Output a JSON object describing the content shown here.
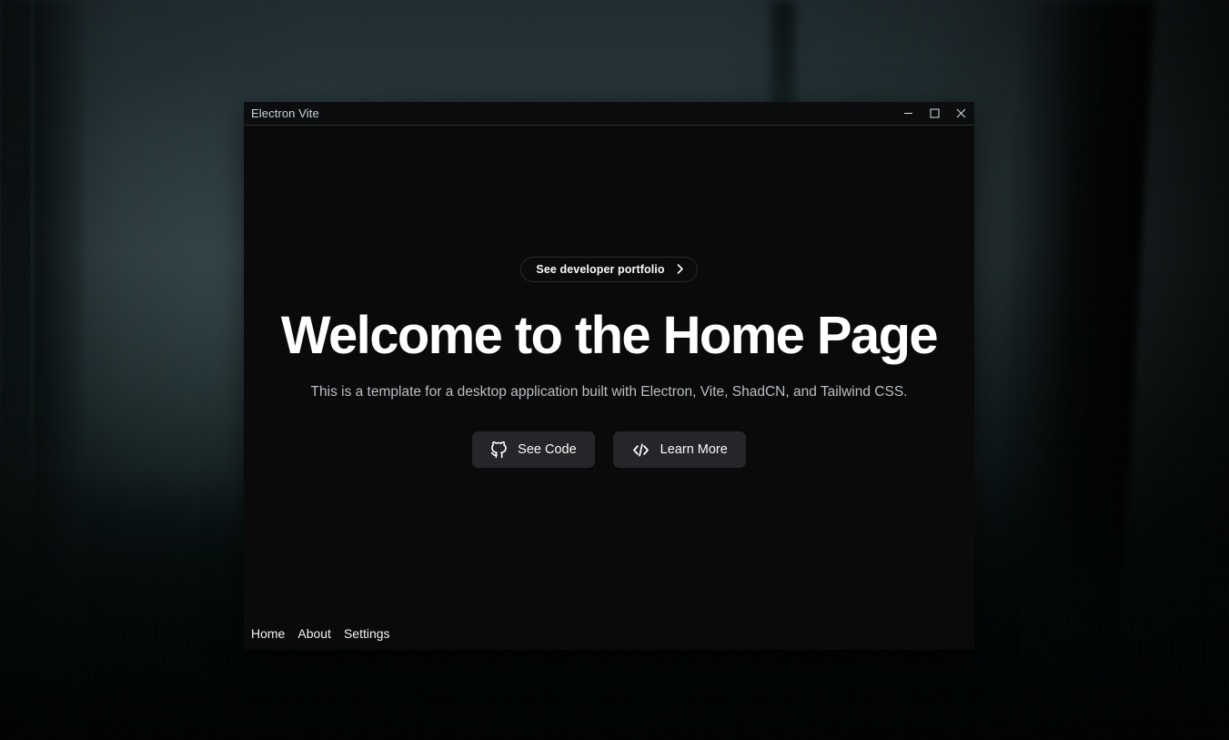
{
  "window": {
    "title": "Electron Vite",
    "controls": [
      {
        "name": "minimize",
        "label": "Minimize"
      },
      {
        "name": "maximize",
        "label": "Maximize"
      },
      {
        "name": "close",
        "label": "Close"
      }
    ]
  },
  "hero": {
    "pill": {
      "label": "See developer portfolio",
      "icon": "chevron-right-icon"
    },
    "title": "Welcome to the Home Page",
    "subtitle": "This is a template for a desktop application built with Electron, Vite, ShadCN, and Tailwind CSS.",
    "actions": [
      {
        "label": "See Code",
        "icon": "github-icon"
      },
      {
        "label": "Learn More",
        "icon": "code-brackets-icon"
      }
    ]
  },
  "bottom_nav": {
    "items": [
      {
        "label": "Home"
      },
      {
        "label": "About"
      },
      {
        "label": "Settings"
      }
    ]
  },
  "colors": {
    "window_background": "#0a0a0a",
    "titlebar_background": "#0b0d0e",
    "titlebar_border": "#2b2f31",
    "title_text": "#c9d4dc",
    "heading_text": "#ffffff",
    "subtitle_text": "#b9bfc6",
    "button_background": "#26262a",
    "button_text": "#fafafa",
    "pill_border": "#2a2a2d",
    "desktop_background": "#0c1417"
  }
}
